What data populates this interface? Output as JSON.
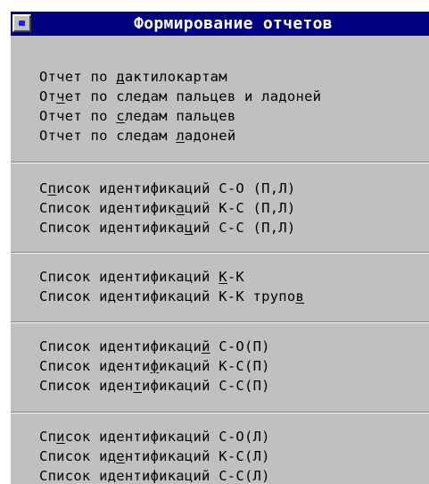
{
  "window": {
    "title": "Формирование отчетов",
    "system_button": "system-menu-button"
  },
  "groups": [
    {
      "items": [
        {
          "pre": "Отчет по ",
          "hot": "д",
          "post": "актилокартам"
        },
        {
          "pre": "От",
          "hot": "ч",
          "post": "ет по следам пальцев и ладоней"
        },
        {
          "pre": "Отчет по ",
          "hot": "с",
          "post": "ледам пальцев"
        },
        {
          "pre": "Отчет по следам ",
          "hot": "л",
          "post": "адоней"
        }
      ]
    },
    {
      "items": [
        {
          "pre": "С",
          "hot": "п",
          "post": "исок идентификаций С-О (П,Л)"
        },
        {
          "pre": "Список идентифик",
          "hot": "а",
          "post": "ций К-С (П,Л)"
        },
        {
          "pre": "Список идентифика",
          "hot": "ц",
          "post": "ий С-С (П,Л)"
        }
      ]
    },
    {
      "items": [
        {
          "pre": "Список идентификаций ",
          "hot": "К",
          "post": "-К"
        },
        {
          "pre": "Список идентификаций К-К трупо",
          "hot": "в",
          "post": ""
        }
      ]
    },
    {
      "items": [
        {
          "pre": "Список идентификаци",
          "hot": "й",
          "post": " С-О(П)"
        },
        {
          "pre": "Список иденти",
          "hot": "ф",
          "post": "икаций К-С(П)"
        },
        {
          "pre": "Список иден",
          "hot": "т",
          "post": "ификаций С-С(П)"
        }
      ]
    },
    {
      "items": [
        {
          "pre": "Сп",
          "hot": "и",
          "post": "сок идентификаций С-О(Л)"
        },
        {
          "pre": "Список ид",
          "hot": "е",
          "post": "нтификаций К-С(Л)"
        },
        {
          "pre": "Список идентификаций С-С(Л)",
          "hot": "",
          "post": ""
        }
      ]
    }
  ]
}
